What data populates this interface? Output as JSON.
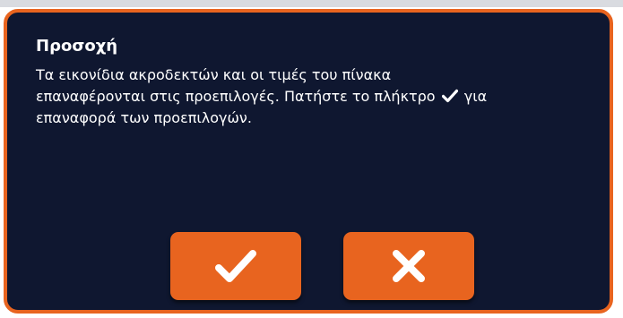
{
  "dialog": {
    "title": "Προσοχή",
    "message_line1": "Τα εικονίδια ακροδεκτών και οι τιμές του πίνακα",
    "message_line2_before": "επαναφέρονται στις προεπιλογές. Πατήστε το πλήκτρο",
    "message_line2_after": "για",
    "message_line3": "επαναφορά των προεπιλογών.",
    "inline_icon": "checkmark-icon",
    "buttons": [
      {
        "name": "confirm",
        "icon": "checkmark-icon"
      },
      {
        "name": "cancel",
        "icon": "x-icon"
      }
    ]
  },
  "colors": {
    "background": "#0f1730",
    "accent": "#e8641f",
    "text": "#ffffff"
  }
}
